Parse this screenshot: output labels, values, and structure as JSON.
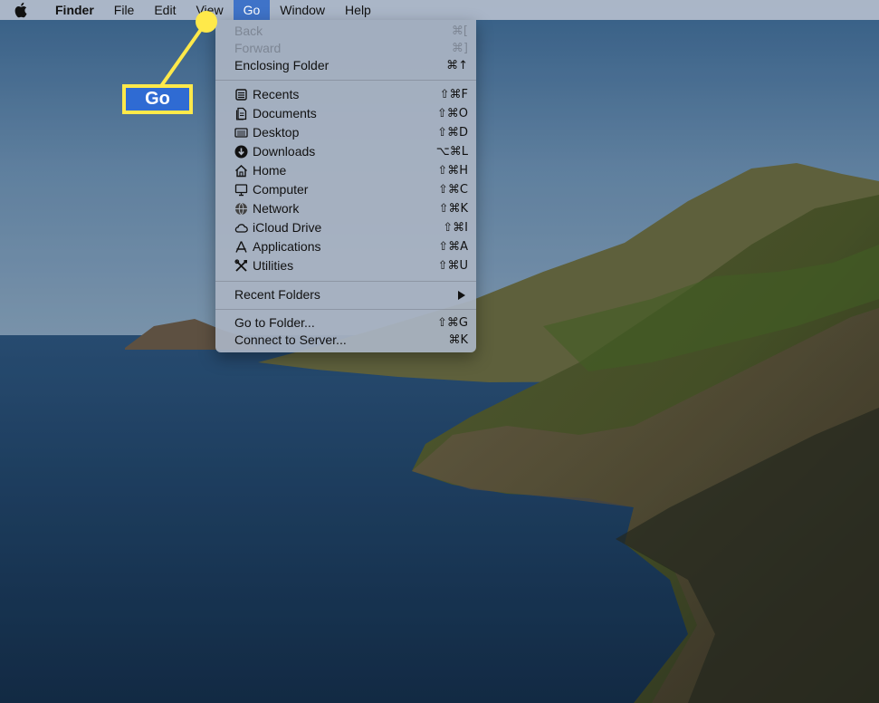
{
  "menubar": {
    "app_name": "Finder",
    "items": [
      "File",
      "Edit",
      "View",
      "Go",
      "Window",
      "Help"
    ]
  },
  "go_menu": {
    "nav": [
      {
        "label": "Back",
        "shortcut": "⌘[",
        "enabled": false
      },
      {
        "label": "Forward",
        "shortcut": "⌘]",
        "enabled": false
      },
      {
        "label": "Enclosing Folder",
        "shortcut": "⌘↑",
        "enabled": true
      }
    ],
    "places": [
      {
        "label": "Recents",
        "shortcut": "⇧⌘F",
        "icon": "recents-icon"
      },
      {
        "label": "Documents",
        "shortcut": "⇧⌘O",
        "icon": "documents-icon"
      },
      {
        "label": "Desktop",
        "shortcut": "⇧⌘D",
        "icon": "desktop-icon"
      },
      {
        "label": "Downloads",
        "shortcut": "⌥⌘L",
        "icon": "downloads-icon"
      },
      {
        "label": "Home",
        "shortcut": "⇧⌘H",
        "icon": "home-icon"
      },
      {
        "label": "Computer",
        "shortcut": "⇧⌘C",
        "icon": "computer-icon"
      },
      {
        "label": "Network",
        "shortcut": "⇧⌘K",
        "icon": "network-icon"
      },
      {
        "label": "iCloud Drive",
        "shortcut": "⇧⌘I",
        "icon": "icloud-icon"
      },
      {
        "label": "Applications",
        "shortcut": "⇧⌘A",
        "icon": "applications-icon"
      },
      {
        "label": "Utilities",
        "shortcut": "⇧⌘U",
        "icon": "utilities-icon"
      }
    ],
    "recent_folders": "Recent Folders",
    "goto": [
      {
        "label": "Go to Folder...",
        "shortcut": "⇧⌘G"
      },
      {
        "label": "Connect to Server...",
        "shortcut": "⌘K"
      }
    ]
  },
  "callout": {
    "label": "Go"
  },
  "colors": {
    "highlight": "#3f73c8",
    "callout": "#ffe94a"
  }
}
